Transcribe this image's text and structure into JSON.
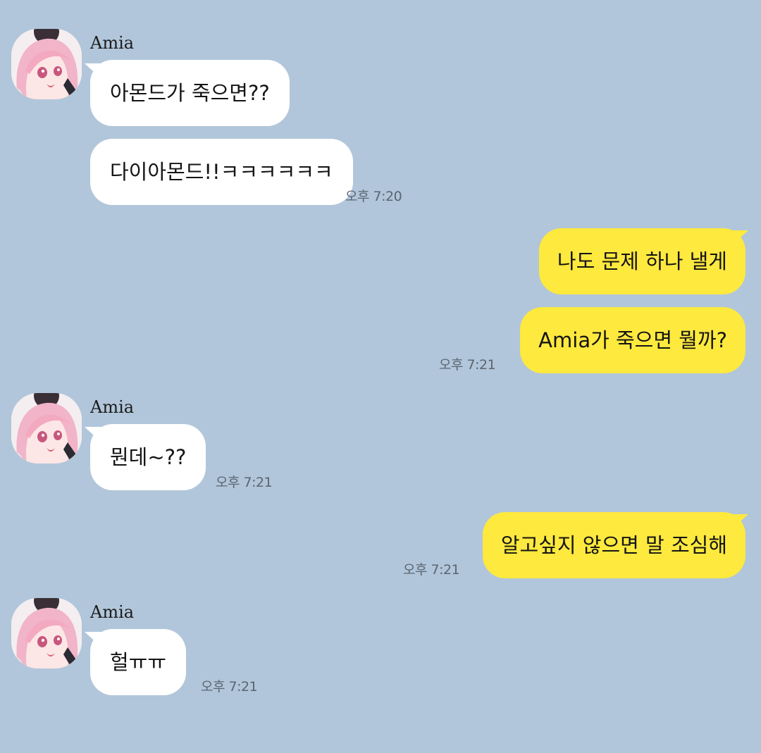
{
  "theme": {
    "background": "#b1c6da",
    "incoming_bubble": "#ffffff",
    "outgoing_bubble": "#fee93e"
  },
  "messages": [
    {
      "sender": "Amia",
      "avatar": "profile-avatar",
      "text": "아몬드가 죽으면??",
      "direction": "incoming"
    },
    {
      "text": "다이아몬드!!ㅋㅋㅋㅋㅋㅋ",
      "time": "오후 7:20",
      "direction": "incoming"
    },
    {
      "text": "나도 문제 하나 낼게",
      "direction": "outgoing"
    },
    {
      "text": "Amia가 죽으면 뭘까?",
      "time": "오후 7:21",
      "direction": "outgoing"
    },
    {
      "sender": "Amia",
      "avatar": "profile-avatar",
      "text": "뭔데~??",
      "time": "오후 7:21",
      "direction": "incoming"
    },
    {
      "text": "알고싶지 않으면 말 조심해",
      "time": "오후 7:21",
      "direction": "outgoing"
    },
    {
      "sender": "Amia",
      "avatar": "profile-avatar",
      "text": "헐ㅠㅠ",
      "time": "오후 7:21",
      "direction": "incoming"
    }
  ]
}
